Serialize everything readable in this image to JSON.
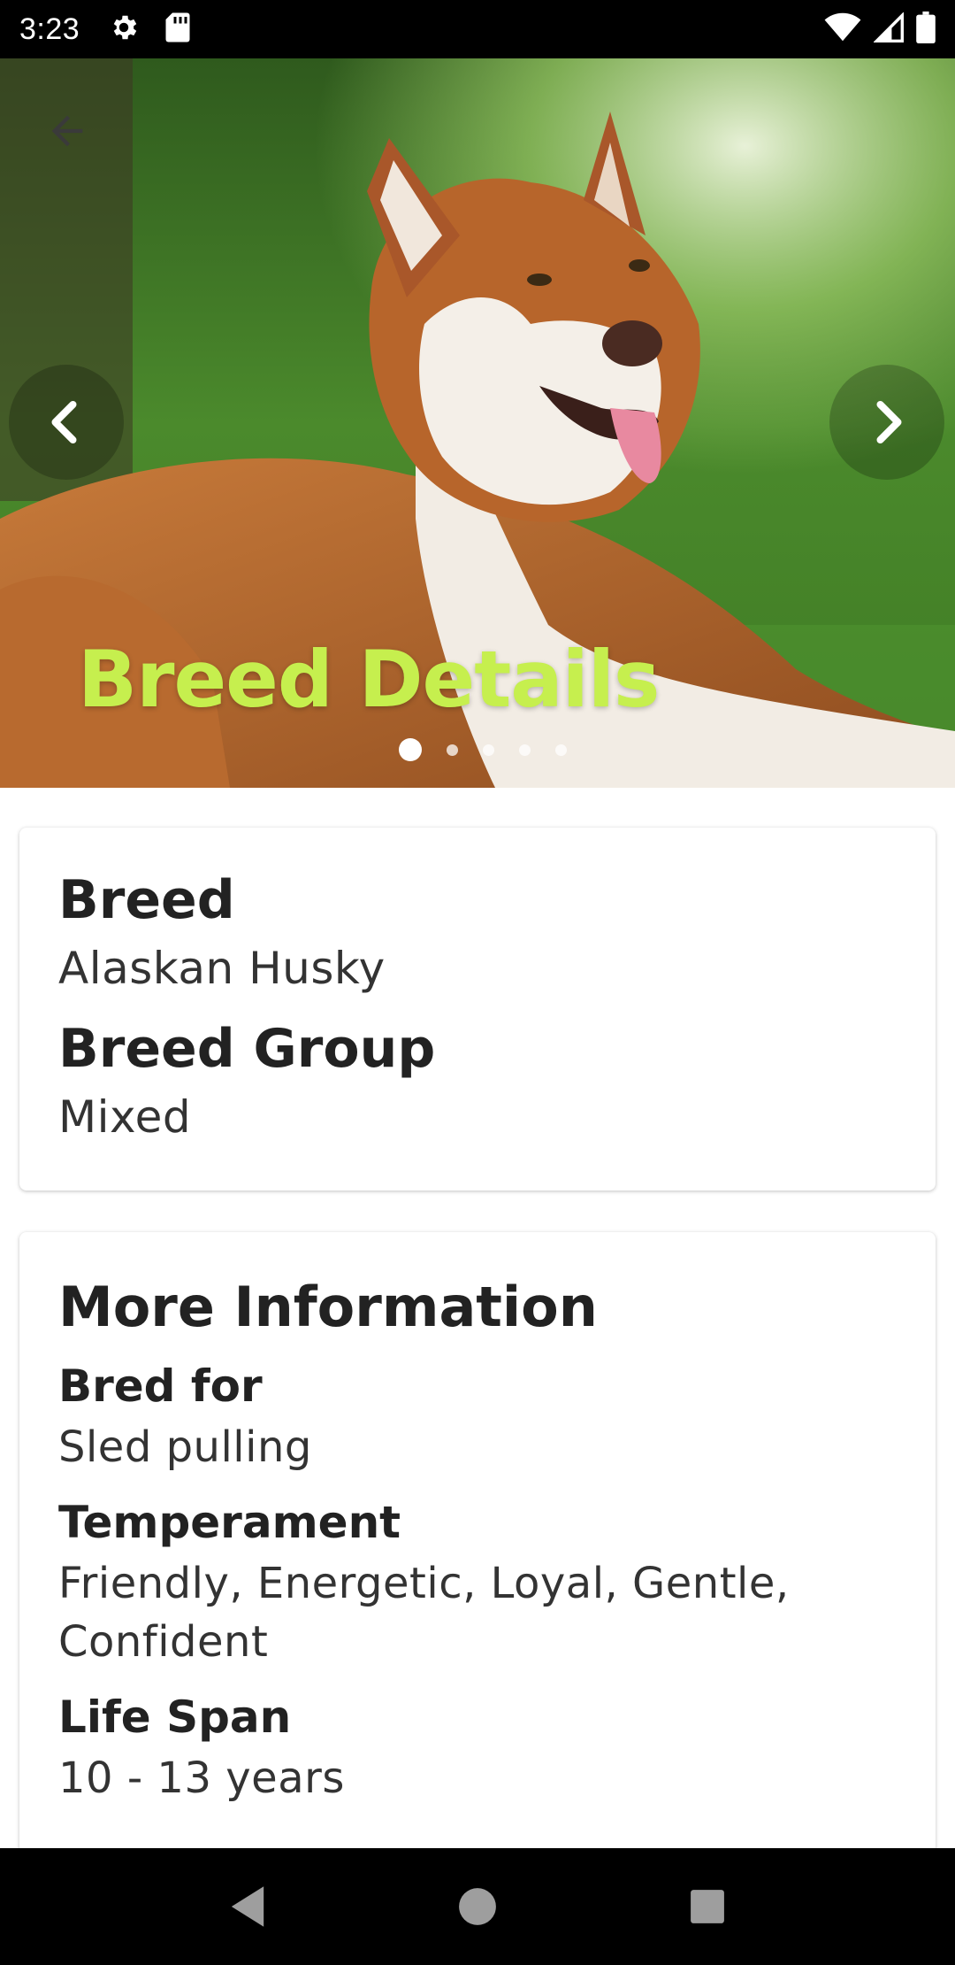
{
  "status_bar": {
    "time": "3:23",
    "icons_left": [
      "gear-icon",
      "sd-card-icon"
    ],
    "icons_right": [
      "wifi-icon",
      "signal-icon",
      "battery-icon"
    ]
  },
  "hero": {
    "title": "Breed Details",
    "title_color": "#c6ef4e",
    "image": "alaskan-husky-photo",
    "carousel": {
      "pages": 5,
      "active_index": 0
    },
    "icons": [
      "back-arrow-icon",
      "chevron-left-icon",
      "chevron-right-icon"
    ]
  },
  "breed_card": {
    "breed_label": "Breed",
    "breed_value": "Alaskan Husky",
    "group_label": "Breed Group",
    "group_value": "Mixed"
  },
  "more_info": {
    "title": "More Information",
    "bred_for_label": "Bred for",
    "bred_for_value": "Sled pulling",
    "temperament_label": "Temperament",
    "temperament_value": "Friendly, Energetic, Loyal, Gentle, Confident",
    "life_span_label": "Life Span",
    "life_span_value": "10 - 13 years"
  },
  "nav_bar": {
    "icons": [
      "back-triangle-icon",
      "home-circle-icon",
      "recents-square-icon"
    ]
  }
}
